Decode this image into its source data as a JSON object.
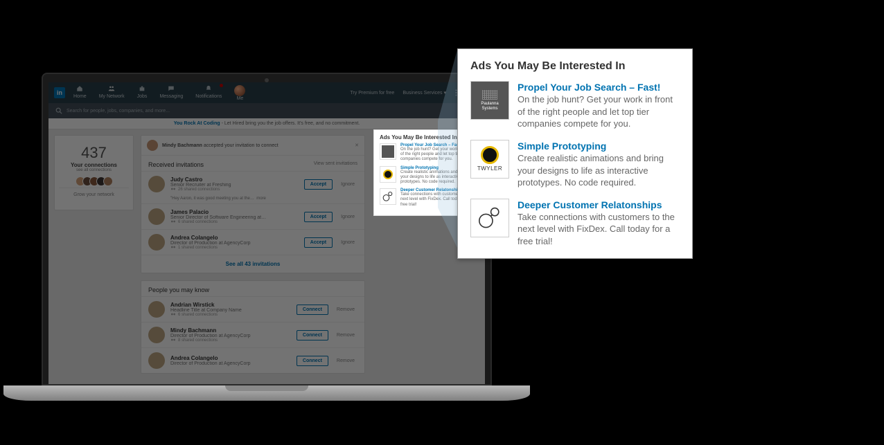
{
  "nav": {
    "logo": "in",
    "items": [
      {
        "label": "Home"
      },
      {
        "label": "My Network"
      },
      {
        "label": "Jobs"
      },
      {
        "label": "Messaging"
      },
      {
        "label": "Notifications"
      },
      {
        "label": "Me"
      }
    ],
    "premium": "Try Premium for free",
    "business": "Business Services"
  },
  "search": {
    "placeholder": "Search for people, jobs, companies, and more..."
  },
  "banner": {
    "bold": "You Rock At Coding",
    "text": " - Let Hired bring you the job offers. It's free, and no commitment."
  },
  "connections": {
    "count": "437",
    "label": "Your connections",
    "sub": "see all connections",
    "footer": "Grow your network"
  },
  "notif": {
    "name": "Mindy Bachmann",
    "msg": " accepted your invitation to connect"
  },
  "invitesHead": {
    "title": "Received invitations",
    "link": "View sent invitations"
  },
  "invites": [
    {
      "name": "Judy Castro",
      "title": "Senior Recruiter at Freshing",
      "meta": "26 shared connections",
      "msg": "\"Hey Aaron, it was good meeting you at the…",
      "more": "more"
    },
    {
      "name": "James Palacio",
      "title": "Senior Director of Software Engineering at…",
      "meta": "6 shared connections"
    },
    {
      "name": "Andrea Colangelo",
      "title": "Director of Production at AgencyCorp",
      "meta": "1 shared connections"
    }
  ],
  "seeAll": "See all 43 invitations",
  "pymkHead": "People you may know",
  "pymk": [
    {
      "name": "Andrian Wirstick",
      "title": "Headline Title at Company Name",
      "meta": "6 shared connections"
    },
    {
      "name": "Mindy Bachmann",
      "title": "Director of Production at AgencyCorp",
      "meta": "8 shared connections"
    },
    {
      "name": "Andrea Colangelo",
      "title": "Director of Production at AgencyCorp"
    }
  ],
  "buttons": {
    "accept": "Accept",
    "ignore": "Ignore",
    "connect": "Connect",
    "remove": "Remove"
  },
  "ads": {
    "header": "Ads You May Be Interested In",
    "items": [
      {
        "title": "Propel Your Job Search – Fast!",
        "desc": "On the job hunt? Get your work in front of the right people and let top tier companies compete for you.",
        "brand": "Paulanna Systems"
      },
      {
        "title": "Simple Prototyping",
        "desc": "Create realistic animations and bring your designs to life as interactive prototypes. No code required.",
        "brand": "TWYLER"
      },
      {
        "title": "Deeper Customer Relatonships",
        "desc": "Take connections with customers to the next level with FixDex. Call today for a free trial!",
        "brand": ""
      }
    ]
  }
}
